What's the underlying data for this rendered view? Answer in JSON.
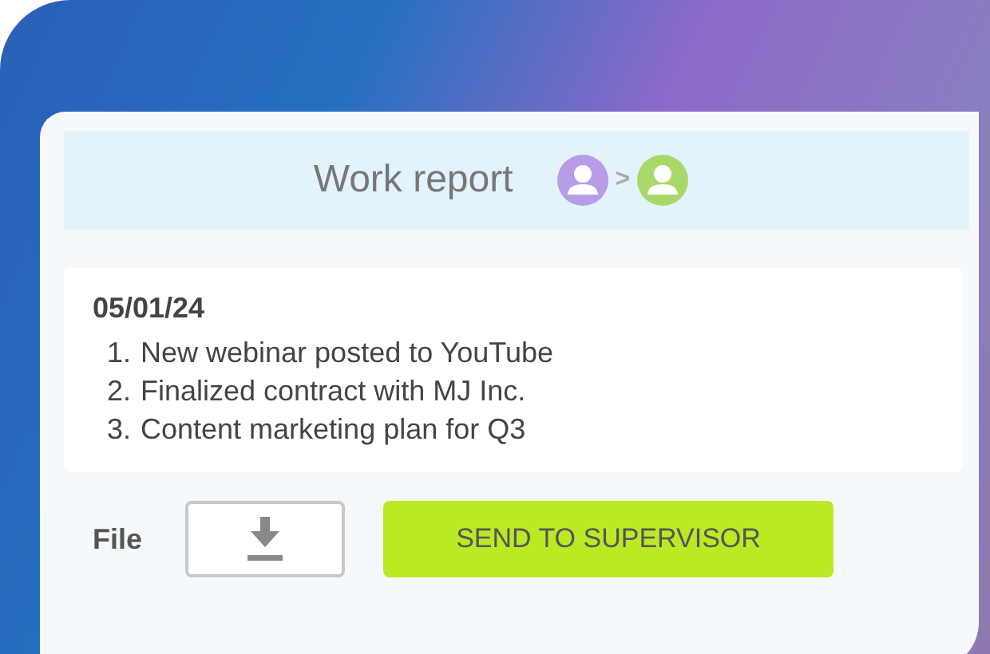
{
  "header": {
    "title": "Work report",
    "avatars": [
      {
        "color": "#b79ce8"
      },
      {
        "color": "#a9d86a"
      }
    ],
    "separator": ">"
  },
  "report": {
    "date": "05/01/24",
    "items": [
      {
        "number": "1.",
        "text": "New webinar posted to YouTube"
      },
      {
        "number": "2.",
        "text": "Finalized contract with MJ Inc."
      },
      {
        "number": "3.",
        "text": "Content marketing plan for Q3"
      }
    ]
  },
  "file": {
    "label": "File"
  },
  "send_button": {
    "label": "SEND TO SUPERVISOR"
  }
}
